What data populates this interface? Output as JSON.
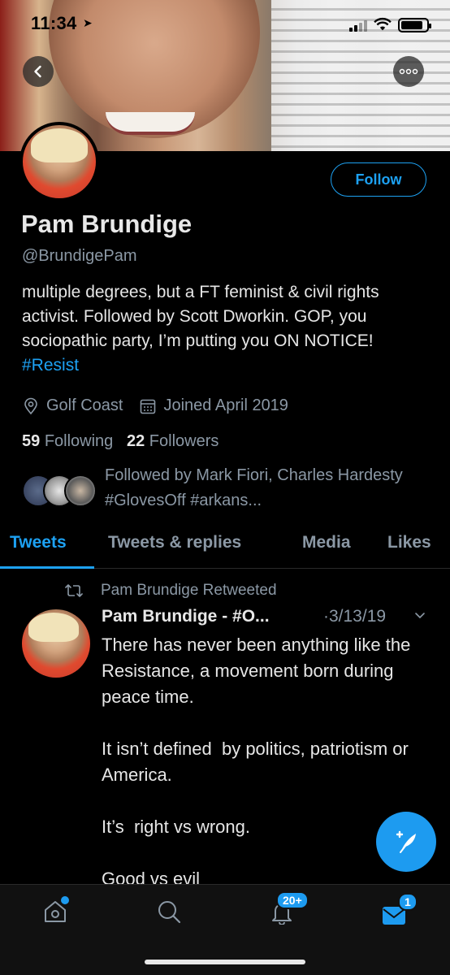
{
  "status_bar": {
    "time": "11:34"
  },
  "profile": {
    "name": "Pam Brundige",
    "handle": "@BrundigePam",
    "follow_label": "Follow",
    "bio_text": "multiple degrees, but a FT feminist & civil rights activist. Followed by Scott Dworkin. GOP, you sociopathic party, I’m putting you ON NOTICE! ",
    "bio_hashtag": "#Resist",
    "location": "Golf Coast",
    "joined": "Joined April 2019",
    "following_count": "59",
    "following_label": "Following",
    "followers_count": "22",
    "followers_label": "Followers",
    "followed_by": "Followed by Mark Fiori, Charles Hardesty #GlovesOff #arkans..."
  },
  "tabs": [
    {
      "label": "Tweets",
      "active": true
    },
    {
      "label": "Tweets & replies"
    },
    {
      "label": "Media"
    },
    {
      "label": "Likes"
    }
  ],
  "tweet": {
    "retweet_label": "Pam Brundige Retweeted",
    "author": "Pam Brundige - #O...",
    "date": "·3/13/19",
    "body": "There has never been anything like the Resistance, a movement born during peace time.\n\nIt isn’t defined  by politics, patriotism or America.\n\nIt’s  right vs wrong.\n\nGood vs evil"
  },
  "bottom_nav": {
    "notifications_badge": "20+",
    "messages_badge": "1"
  },
  "colors": {
    "accent": "#1da1f2",
    "muted": "#8b98a5",
    "background": "#000000"
  }
}
